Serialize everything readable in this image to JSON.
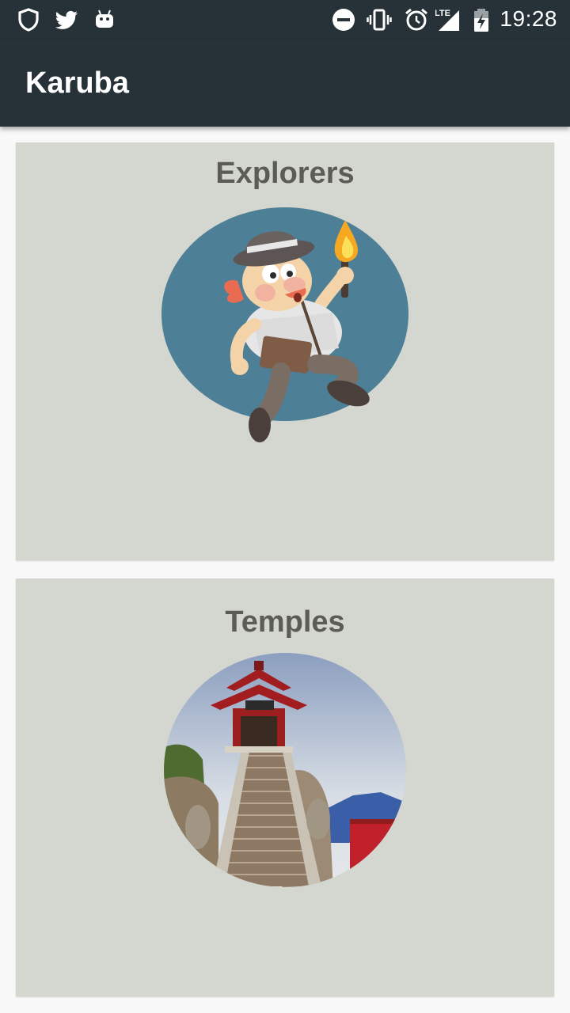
{
  "status_bar": {
    "time": "19:28",
    "left_icons": [
      "shield-icon",
      "twitter-icon",
      "android-icon"
    ],
    "right_icons": [
      "do-not-disturb-icon",
      "vibrate-icon",
      "alarm-icon",
      "lte-signal-icon",
      "battery-charging-icon"
    ],
    "network_label": "LTE"
  },
  "app_bar": {
    "title": "Karuba",
    "color": "#263238"
  },
  "cards": [
    {
      "title": "Explorers",
      "image": "explorer-illustration"
    },
    {
      "title": "Temples",
      "image": "temple-photo"
    }
  ],
  "colors": {
    "card_background": "#d4d6d0",
    "card_title": "#5b5c58",
    "page_background": "#f8f8f8"
  }
}
